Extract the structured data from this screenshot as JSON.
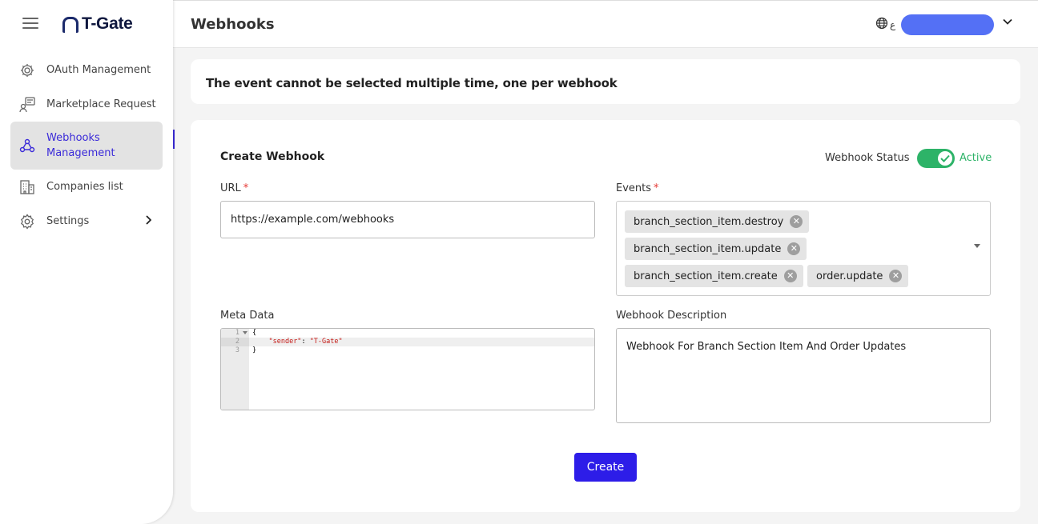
{
  "app": {
    "brand": "T-Gate",
    "page_title": "Webhooks"
  },
  "header": {
    "lang_glyph": "ع"
  },
  "sidebar": {
    "items": [
      {
        "label": "OAuth Management",
        "icon": "oauth-gear-icon"
      },
      {
        "label": "Marketplace Request",
        "icon": "marketplace-request-icon"
      },
      {
        "label": "Webhooks Management",
        "icon": "webhook-icon",
        "active": true
      },
      {
        "label": "Companies list",
        "icon": "companies-building-icon"
      },
      {
        "label": "Settings",
        "icon": "settings-gear-icon",
        "has_submenu": true
      }
    ]
  },
  "notice": {
    "text": "The event cannot be selected multiple time, one per webhook"
  },
  "form": {
    "title": "Create Webhook",
    "status_label": "Webhook Status",
    "status_value": "Active",
    "status_on": true,
    "url_label": "URL",
    "url_value": "https://example.com/webhooks",
    "events_label": "Events",
    "events": [
      "branch_section_item.destroy",
      "branch_section_item.update",
      "branch_section_item.create",
      "order.update"
    ],
    "meta_label": "Meta Data",
    "meta_lines": [
      "1",
      "2",
      "3"
    ],
    "meta_code": {
      "open": "{",
      "key": "\"sender\"",
      "sep": ": ",
      "value": "\"T-Gate\"",
      "close": "}"
    },
    "description_label": "Webhook Description",
    "description_value": "Webhook For Branch Section Item And Order Updates",
    "submit_label": "Create"
  },
  "colors": {
    "accent": "#2d1de8",
    "active_nav_text": "#3b2bd9",
    "toggle_on": "#2db368",
    "user_pill": "#5470f5",
    "required": "#e53935"
  }
}
